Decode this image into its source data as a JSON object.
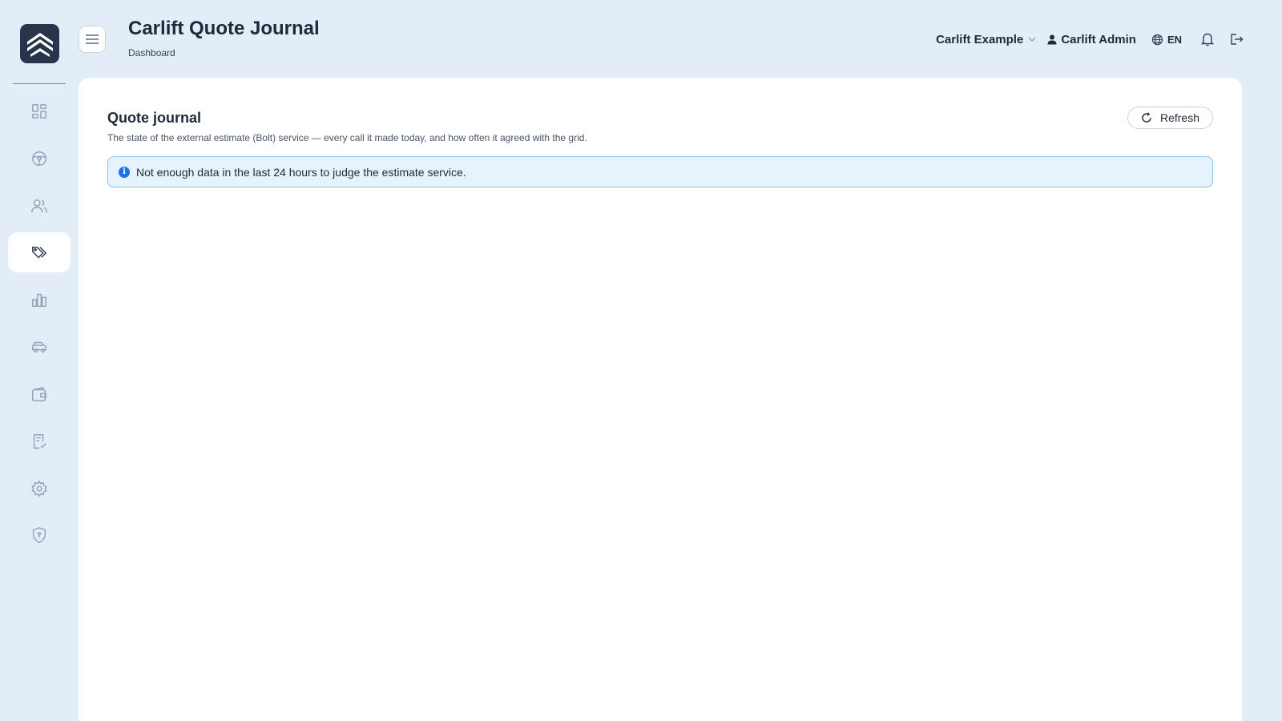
{
  "app": {
    "title": "Carlift Quote Journal",
    "breadcrumb": "Dashboard"
  },
  "header": {
    "organization": "Carlift Example",
    "user": "Carlift Admin",
    "language": "EN"
  },
  "sidebar": {
    "items": [
      {
        "icon": "dashboard-icon",
        "active": false
      },
      {
        "icon": "steering-wheel-icon",
        "active": false
      },
      {
        "icon": "users-icon",
        "active": false
      },
      {
        "icon": "tags-icon",
        "active": true
      },
      {
        "icon": "bar-chart-icon",
        "active": false
      },
      {
        "icon": "car-icon",
        "active": false
      },
      {
        "icon": "wallet-icon",
        "active": false
      },
      {
        "icon": "checklist-icon",
        "active": false
      },
      {
        "icon": "settings-icon",
        "active": false
      },
      {
        "icon": "shield-icon",
        "active": false
      }
    ]
  },
  "main": {
    "section_title": "Quote journal",
    "section_description": "The state of the external estimate (Bolt) service — every call it made today, and how often it agreed with the grid.",
    "refresh_label": "Refresh",
    "alert_text": "Not enough data in the last 24 hours to judge the estimate service."
  },
  "colors": {
    "background": "#e3edf8",
    "logo": "#27344a",
    "icon": "#94a3b8",
    "info_accent": "#1d72e8"
  }
}
